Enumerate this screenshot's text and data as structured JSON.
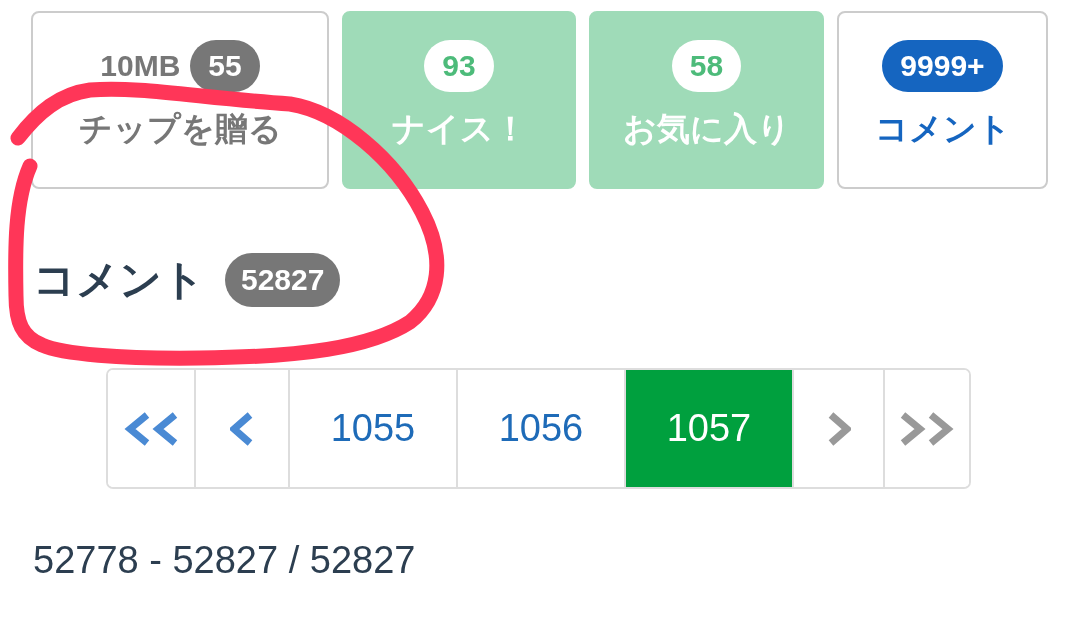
{
  "actions": [
    {
      "kind": "tip",
      "size": "10MB",
      "count": "55",
      "label": "チップを贈る",
      "active": false
    },
    {
      "kind": "nice",
      "count": "93",
      "label": "ナイス！",
      "active": true
    },
    {
      "kind": "favorite",
      "count": "58",
      "label": "お気に入り",
      "active": true
    },
    {
      "kind": "comment",
      "count": "9999+",
      "label": "コメント",
      "active": false
    }
  ],
  "comments": {
    "title": "コメント",
    "count": "52827"
  },
  "pagination": [
    {
      "kind": "first",
      "selected": false,
      "disabled": false
    },
    {
      "kind": "prev",
      "selected": false,
      "disabled": false
    },
    {
      "kind": "page",
      "label": "1055",
      "selected": false,
      "disabled": false
    },
    {
      "kind": "page",
      "label": "1056",
      "selected": false,
      "disabled": false
    },
    {
      "kind": "page",
      "label": "1057",
      "selected": true,
      "disabled": false
    },
    {
      "kind": "next",
      "selected": false,
      "disabled": true
    },
    {
      "kind": "last",
      "selected": false,
      "disabled": true
    }
  ],
  "range": "52778 - 52827 / 52827",
  "annotation": {
    "kind": "loop"
  }
}
